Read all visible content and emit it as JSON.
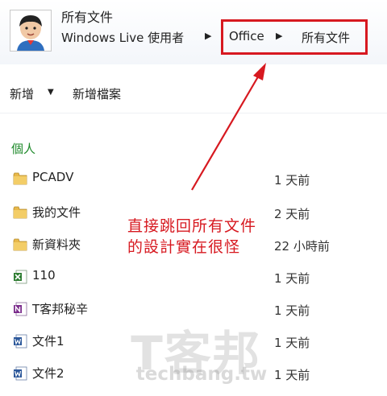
{
  "header": {
    "title": "所有文件",
    "breadcrumb": [
      "Windows Live 使用者",
      "Office",
      "所有文件"
    ]
  },
  "toolbar": {
    "new_label": "新增",
    "new_document_label": "新增檔案"
  },
  "section": {
    "title": "個人"
  },
  "files": [
    {
      "name": "PCADV",
      "time": "1 天前",
      "icon": "folder-icon"
    },
    {
      "name": "我的文件",
      "time": "2 天前",
      "icon": "folder-icon"
    },
    {
      "name": "新資料夾",
      "time": "22 小時前",
      "icon": "folder-icon"
    },
    {
      "name": "110",
      "time": "1 天前",
      "icon": "excel-icon"
    },
    {
      "name": "T客邦秘辛",
      "time": "1 天前",
      "icon": "onenote-icon"
    },
    {
      "name": "文件1",
      "time": "1 天前",
      "icon": "word-icon"
    },
    {
      "name": "文件2",
      "time": "1 天前",
      "icon": "word-icon"
    }
  ],
  "annotation": {
    "line1": "直接跳回所有文件",
    "line2": "的設計實在很怪"
  },
  "watermark": {
    "brand": "T客邦",
    "domain": "techbang.tw"
  },
  "colors": {
    "highlight": "#d71920",
    "section": "#1f8a2b",
    "folder": "#e8b84a",
    "excel": "#2e7d32",
    "onenote": "#7b2c8c",
    "word": "#2b579a"
  }
}
